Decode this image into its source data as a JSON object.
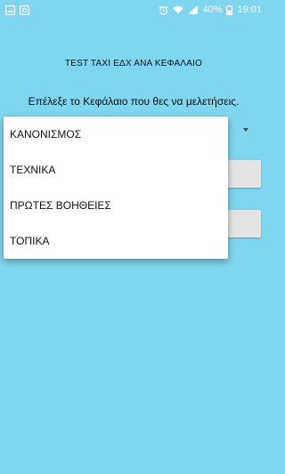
{
  "status_bar": {
    "left_icons": [
      "image-icon",
      "app-notification-icon"
    ],
    "right_icons": [
      "alarm-icon",
      "wifi-icon",
      "signal-icon"
    ],
    "battery": "40%",
    "time": "19:01"
  },
  "main": {
    "title": "TEST TAXI ΕΔΧ ΑΝΑ ΚΕΦΑΛΑΙΟ",
    "instruction": "Επέλεξε το Κεφάλαιο που θες να μελετήσεις."
  },
  "dropdown": {
    "items": [
      {
        "label": "ΚΑΝΟΝΙΣΜΟΣ"
      },
      {
        "label": "ΤΕΧΝΙΚΑ"
      },
      {
        "label": "ΠΡΩΤΕΣ ΒΟΗΘΕΙΕΣ"
      },
      {
        "label": "ΤΟΠΙΚΑ"
      }
    ]
  },
  "colors": {
    "background": "#7fd6f0",
    "popup": "#ffffff",
    "field": "#e4e4e4"
  }
}
